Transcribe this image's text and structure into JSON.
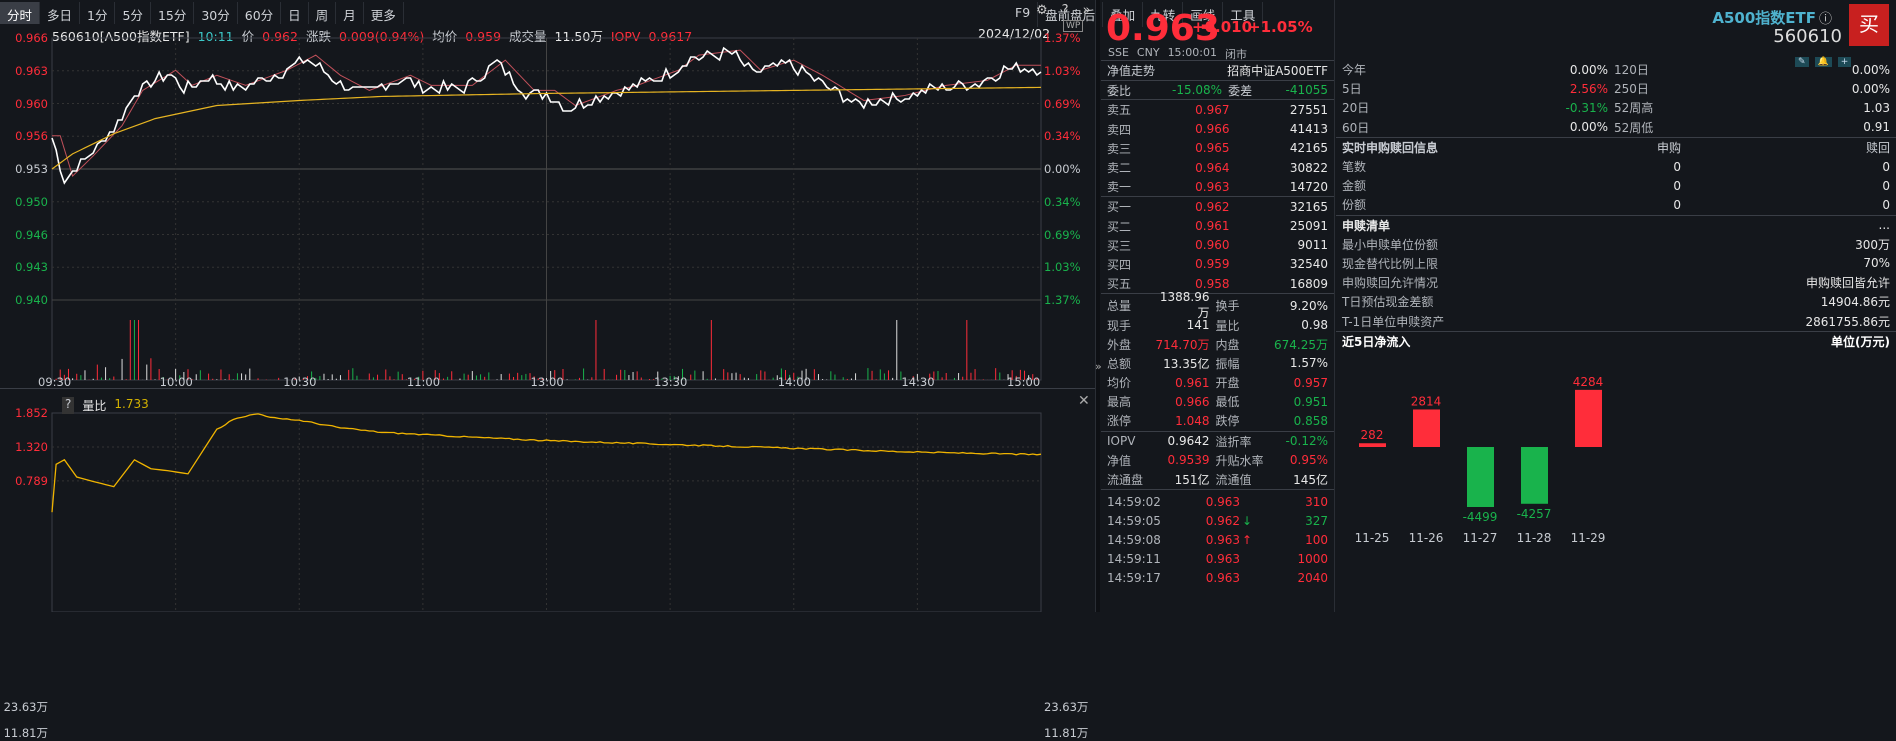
{
  "toolbar": {
    "tabs": [
      "分时",
      "多日",
      "1分",
      "5分",
      "15分",
      "30分",
      "60分",
      "日",
      "周",
      "月",
      "更多"
    ],
    "tools": [
      "F9",
      "盘前盘后",
      "叠加",
      "九转",
      "画线",
      "工具"
    ],
    "icons": [
      "gear-icon",
      "help-icon",
      "double-chevron-right-icon"
    ]
  },
  "infobar": {
    "code_name": "560610[A500指数ETF]",
    "time": "10:11",
    "price_label": "价",
    "price": "0.962",
    "chg_label": "涨跌",
    "chg": "0.009(0.94%)",
    "avg_label": "均价",
    "avg": "0.959",
    "vol_label": "成交量",
    "vol": "11.50万",
    "iopv_label": "IOPV",
    "iopv": "0.9617",
    "date": "2024/12/02"
  },
  "chart_data": [
    {
      "type": "line",
      "title": "",
      "y_ticks_left": [
        "0.966",
        "0.963",
        "0.960",
        "0.956",
        "0.953",
        "0.950",
        "0.946",
        "0.943",
        "0.940"
      ],
      "y_ticks_right": [
        "1.37%",
        "1.03%",
        "0.69%",
        "0.34%",
        "0.00%",
        "0.34%",
        "0.69%",
        "1.03%",
        "1.37%"
      ],
      "ylim": [
        0.94,
        0.966
      ],
      "prev_close": 0.953,
      "x_ticks": [
        "09:30",
        "10:00",
        "10:30",
        "11:00",
        "13:00",
        "13:30",
        "14:00",
        "14:30",
        "15:00"
      ],
      "series": [
        {
          "key": "price",
          "color": "#ffffff",
          "x": [
            0,
            3,
            8,
            15,
            20,
            28,
            32,
            38,
            45,
            55,
            62,
            68,
            75,
            85,
            90,
            100,
            108,
            115,
            120,
            125,
            135,
            140,
            150,
            155,
            165,
            170,
            178,
            185,
            195,
            205,
            215,
            225,
            232,
            240
          ],
          "y": [
            0.956,
            0.952,
            0.954,
            0.957,
            0.9605,
            0.9625,
            0.961,
            0.962,
            0.961,
            0.9625,
            0.964,
            0.962,
            0.9605,
            0.962,
            0.961,
            0.961,
            0.9635,
            0.9605,
            0.9605,
            0.959,
            0.9605,
            0.961,
            0.9625,
            0.964,
            0.9645,
            0.9625,
            0.9635,
            0.962,
            0.9595,
            0.96,
            0.961,
            0.9615,
            0.963,
            0.963
          ]
        },
        {
          "key": "avg",
          "color": "#e6b422",
          "x": [
            0,
            5,
            15,
            25,
            40,
            60,
            80,
            120,
            160,
            200,
            240
          ],
          "y": [
            0.953,
            0.9545,
            0.9565,
            0.958,
            0.9593,
            0.9598,
            0.9602,
            0.9605,
            0.9607,
            0.9609,
            0.9611
          ]
        }
      ]
    },
    {
      "type": "bar",
      "title": "",
      "y_ticks": [
        "23.63万",
        "11.81万"
      ],
      "ylim": [
        0,
        35
      ]
    },
    {
      "type": "line",
      "title": "量比",
      "current": "1.733",
      "y_ticks": [
        "1.852",
        "1.320",
        "0.789"
      ],
      "ylim": [
        0.3,
        1.95
      ],
      "x": [
        0,
        1,
        3,
        6,
        10,
        15,
        20,
        24,
        28,
        33,
        40,
        45,
        50,
        55,
        60,
        70,
        80,
        100,
        120,
        150,
        180,
        210,
        240
      ],
      "y": [
        0.3,
        1.05,
        1.12,
        0.85,
        0.78,
        0.7,
        1.12,
        0.98,
        0.95,
        0.9,
        1.6,
        1.78,
        1.84,
        1.76,
        1.74,
        1.62,
        1.55,
        1.48,
        1.42,
        1.36,
        1.3,
        1.24,
        1.2
      ]
    }
  ],
  "quote": {
    "price": "0.963",
    "chg": "+0.010",
    "pct": "+1.05%",
    "name": "A500指数ETF",
    "code": "560610",
    "buy": "买",
    "meta": [
      "SSE",
      "CNY",
      "15:00:01",
      "闭市"
    ]
  },
  "nav": {
    "label": "净值走势",
    "fund": "招商中证A500ETF"
  },
  "book": {
    "ratio_label": "委比",
    "ratio": "-15.08%",
    "diff_label": "委差",
    "diff": "-41055",
    "asks": [
      [
        "卖五",
        "0.967",
        "27551"
      ],
      [
        "卖四",
        "0.966",
        "41413"
      ],
      [
        "卖三",
        "0.965",
        "42165"
      ],
      [
        "卖二",
        "0.964",
        "30822"
      ],
      [
        "卖一",
        "0.963",
        "14720"
      ]
    ],
    "bids": [
      [
        "买一",
        "0.962",
        "32165"
      ],
      [
        "买二",
        "0.961",
        "25091"
      ],
      [
        "买三",
        "0.960",
        "9011"
      ],
      [
        "买四",
        "0.959",
        "32540"
      ],
      [
        "买五",
        "0.958",
        "16809"
      ]
    ]
  },
  "stats": [
    [
      "总量",
      "1388.96万",
      "w",
      "换手",
      "9.20%",
      "w"
    ],
    [
      "现手",
      "141",
      "w",
      "量比",
      "0.98",
      "w"
    ],
    [
      "外盘",
      "714.70万",
      "r",
      "内盘",
      "674.25万",
      "g"
    ],
    [
      "总额",
      "13.35亿",
      "w",
      "振幅",
      "1.57%",
      "w"
    ],
    [
      "均价",
      "0.961",
      "r",
      "开盘",
      "0.957",
      "r"
    ],
    [
      "最高",
      "0.966",
      "r",
      "最低",
      "0.951",
      "g"
    ],
    [
      "涨停",
      "1.048",
      "r",
      "跌停",
      "0.858",
      "g"
    ]
  ],
  "stats2": [
    [
      "IOPV",
      "0.9642",
      "w",
      "溢折率",
      "-0.12%",
      "g"
    ],
    [
      "净值",
      "0.9539",
      "r",
      "升贴水率",
      "0.95%",
      "r"
    ],
    [
      "流通盘",
      "151亿",
      "w",
      "流通值",
      "145亿",
      "w"
    ]
  ],
  "ticks": [
    [
      "14:59:02",
      "0.963",
      "",
      "310",
      "r"
    ],
    [
      "14:59:05",
      "0.962",
      "↓",
      "327",
      "g"
    ],
    [
      "14:59:08",
      "0.963",
      "↑",
      "100",
      "r"
    ],
    [
      "14:59:11",
      "0.963",
      "",
      "1000",
      "r"
    ],
    [
      "14:59:17",
      "0.963",
      "",
      "2040",
      "r"
    ]
  ],
  "perf": [
    [
      "今年",
      "0.00%",
      "w",
      "120日",
      "0.00%"
    ],
    [
      "5日",
      "2.56%",
      "r",
      "250日",
      "0.00%"
    ],
    [
      "20日",
      "-0.31%",
      "g",
      "52周高",
      "1.03"
    ],
    [
      "60日",
      "0.00%",
      "w",
      "52周低",
      "0.91"
    ]
  ],
  "sr": {
    "title": "实时申购赎回信息",
    "col1": "申购",
    "col2": "赎回",
    "rows": [
      [
        "笔数",
        "0",
        "0"
      ],
      [
        "金额",
        "0",
        "0"
      ],
      [
        "份额",
        "0",
        "0"
      ]
    ]
  },
  "list": {
    "title": "申赎清单",
    "more": "...",
    "rows": [
      [
        "最小申赎单位份额",
        "300万"
      ],
      [
        "现金替代比例上限",
        "70%"
      ],
      [
        "申购赎回允许情况",
        "申购赎回皆允许"
      ],
      [
        "T日预估现金差额",
        "14904.86元"
      ],
      [
        "T-1日单位申赎资产",
        "2861755.86元"
      ]
    ]
  },
  "flow": {
    "title": "近5日净流入",
    "unit": "单位(万元)",
    "categories": [
      "11-25",
      "11-26",
      "11-27",
      "11-28",
      "11-29"
    ],
    "values": [
      282,
      2814,
      -4499,
      -4257,
      4284
    ],
    "pos_color": "#ff2d3a",
    "neg_color": "#19b34c"
  }
}
